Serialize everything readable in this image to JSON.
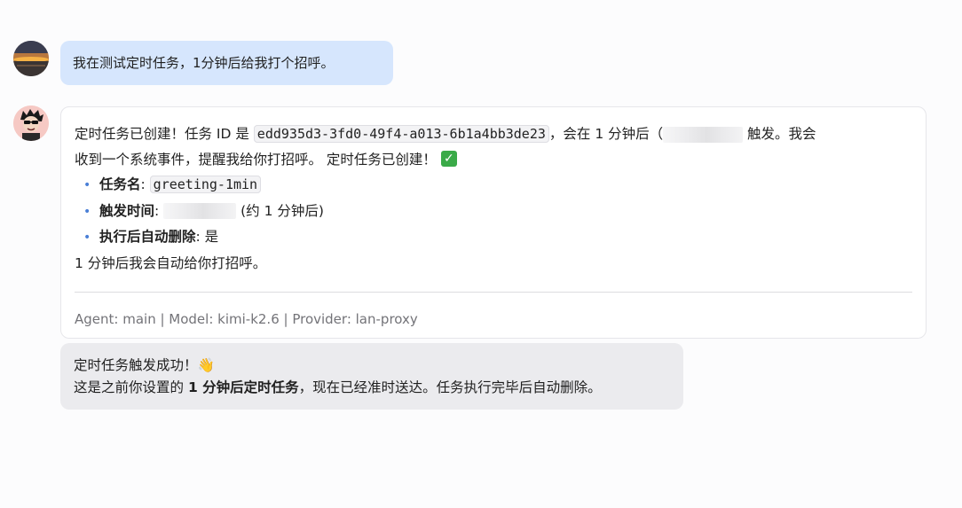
{
  "user_message": {
    "text": "我在测试定时任务，1分钟后给我打个招呼。"
  },
  "assistant_message": {
    "line1_prefix": "定时任务已创建！任务 ID 是 ",
    "task_id": "edd935d3-3fd0-49f4-a013-6b1a4bb3de23",
    "line1_mid": "，会在 1 分钟后（",
    "line1_suffix": " 触发。我会",
    "line2": "收到一个系统事件，提醒我给你打招呼。 定时任务已创建！",
    "check_icon": "✓",
    "details": [
      {
        "label": "任务名",
        "value": "greeting-1min",
        "value_type": "code"
      },
      {
        "label": "触发时间",
        "value": "(约 1 分钟后)",
        "value_type": "redacted_prefix"
      },
      {
        "label": "执行后自动删除",
        "value": "是",
        "value_type": "text"
      }
    ],
    "closing": "1 分钟后我会自动给你打招呼。",
    "meta": "Agent: main | Model: kimi-k2.6 | Provider: lan-proxy"
  },
  "notification_message": {
    "line1": "定时任务触发成功！",
    "wave_emoji": "👋",
    "line2_prefix": "这是之前你设置的 ",
    "line2_bold": "1 分钟后定时任务",
    "line2_suffix": "，现在已经准时送达。任务执行完毕后自动删除。"
  },
  "colors": {
    "user_bubble": "#d6e6fd",
    "card_border": "#e6e6ea",
    "notify_bubble": "#ebebee",
    "bullet": "#4a7fd6",
    "check": "#3aaa48",
    "meta_text": "#737378"
  },
  "icons": {
    "user_avatar": "sunset-avatar",
    "bot_avatar": "cartoon-character-avatar"
  }
}
